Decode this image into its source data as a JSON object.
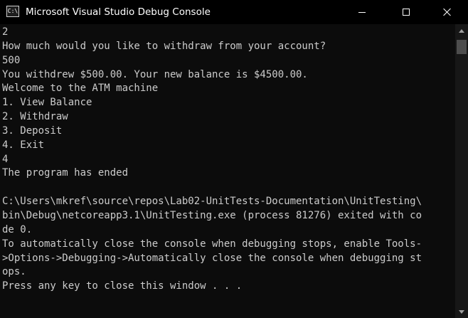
{
  "window": {
    "title": "Microsoft Visual Studio Debug Console",
    "icon": "console-app-icon",
    "icon_label": "C:\\",
    "controls": {
      "minimize_icon": "minimize-icon",
      "maximize_icon": "maximize-icon",
      "close_icon": "close-icon"
    }
  },
  "console": {
    "lines": [
      "2",
      "How much would you like to withdraw from your account?",
      "500",
      "You withdrew $500.00. Your new balance is $4500.00.",
      "Welcome to the ATM machine",
      "1. View Balance",
      "2. Withdraw",
      "3. Deposit",
      "4. Exit",
      "4",
      "The program has ended",
      "",
      "C:\\Users\\mkref\\source\\repos\\Lab02-UnitTests-Documentation\\UnitTesting\\",
      "bin\\Debug\\netcoreapp3.1\\UnitTesting.exe (process 81276) exited with co",
      "de 0.",
      "To automatically close the console when debugging stops, enable Tools-",
      ">Options->Debugging->Automatically close the console when debugging st",
      "ops.",
      "Press any key to close this window . . ."
    ]
  },
  "colors": {
    "background": "#0c0c0c",
    "foreground": "#cccccc",
    "titlebar": "#000000"
  }
}
